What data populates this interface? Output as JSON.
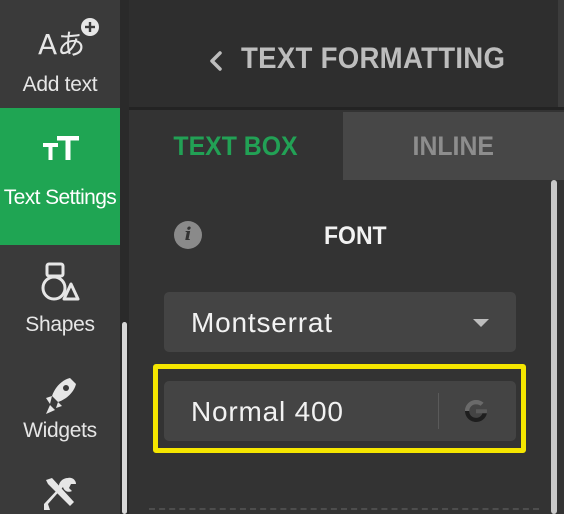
{
  "sidebar": {
    "items": [
      {
        "label": "Add text",
        "icon": "add-text-icon",
        "active": false
      },
      {
        "label": "Text Settings",
        "icon": "text-settings-icon",
        "active": true
      },
      {
        "label": "Shapes",
        "icon": "shapes-icon",
        "active": false
      },
      {
        "label": "Widgets",
        "icon": "rocket-icon",
        "active": false
      },
      {
        "label": "",
        "icon": "tools-icon",
        "active": false
      }
    ],
    "add_text_glyph": "Aあ",
    "text_settings_glyph": "тT",
    "active_color": "#1fa553"
  },
  "panel": {
    "title": "TEXT FORMATTING",
    "tabs": [
      {
        "label": "TEXT BOX",
        "active": true
      },
      {
        "label": "INLINE",
        "active": false
      }
    ],
    "font_section_label": "FONT",
    "info_glyph": "i",
    "font_family": {
      "value": "Montserrat"
    },
    "font_weight": {
      "value": "Normal 400",
      "source_icon": "google-icon"
    },
    "accent_color": "#22a155",
    "highlight_color": "#f5e600"
  }
}
